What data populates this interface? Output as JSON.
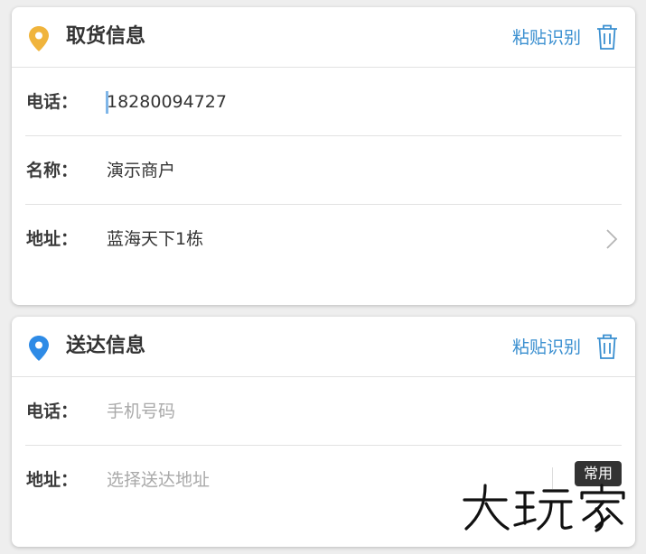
{
  "pickup": {
    "title": "取货信息",
    "paste_label": "粘贴识别",
    "icon_color": "#f0b43c",
    "fields": [
      {
        "label": "电话：",
        "value": "18280094727"
      },
      {
        "label": "名称：",
        "value": "演示商户"
      },
      {
        "label": "地址：",
        "value": "蓝海天下1栋"
      }
    ]
  },
  "delivery": {
    "title": "送达信息",
    "paste_label": "粘贴识别",
    "icon_color": "#2e8be6",
    "fields": [
      {
        "label": "电话：",
        "placeholder": "手机号码"
      },
      {
        "label": "地址：",
        "placeholder": "选择送达地址"
      }
    ],
    "common_label": "常用"
  },
  "watermark": "大玩家",
  "accent_color": "#3a8fd0"
}
